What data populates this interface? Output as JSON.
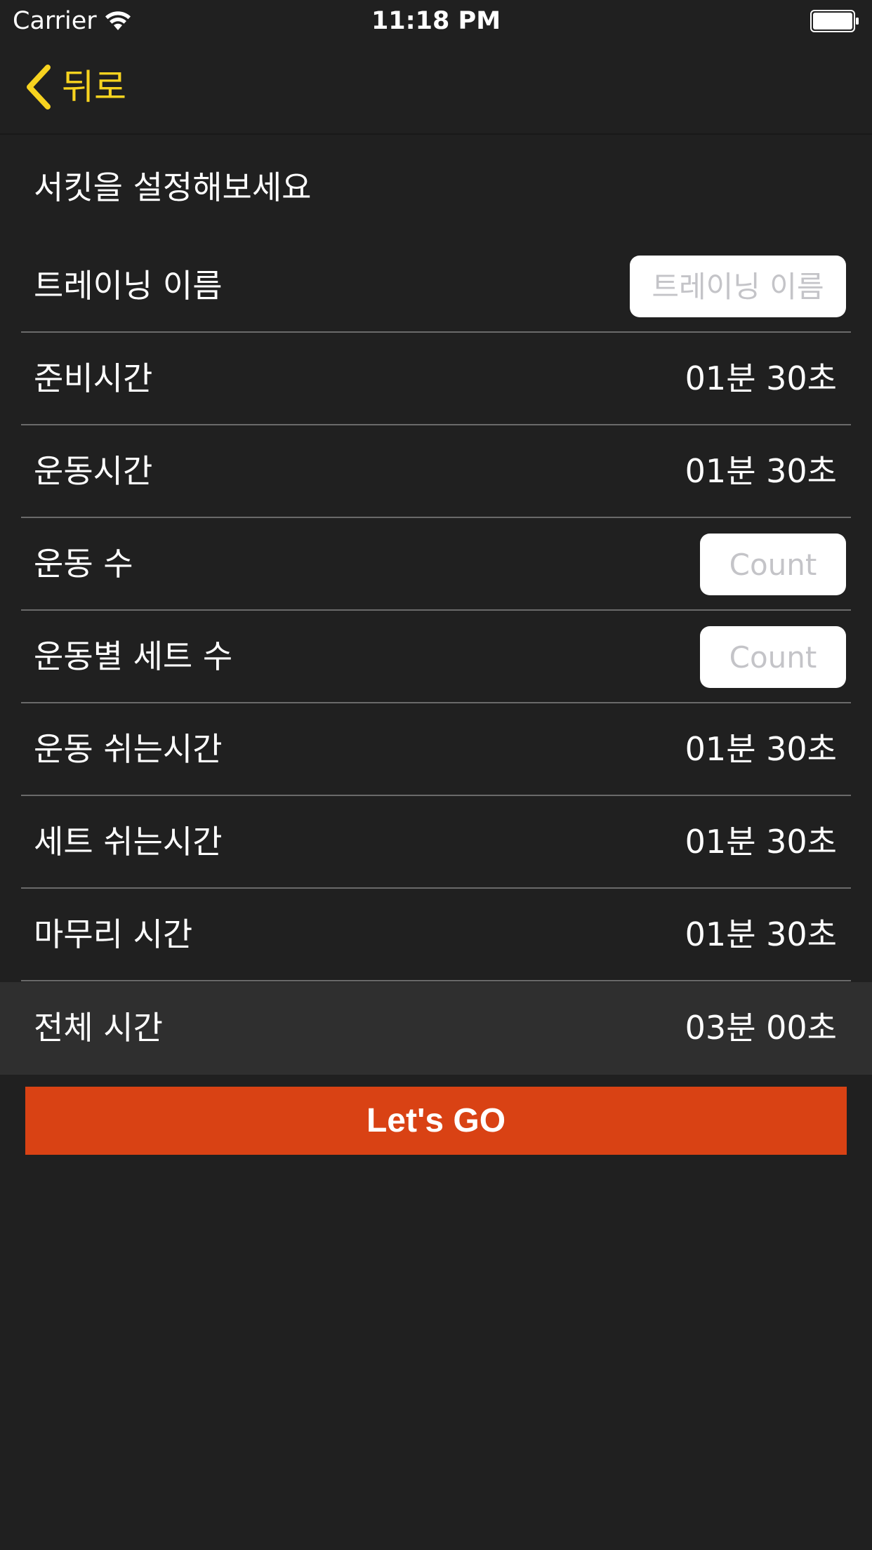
{
  "status_bar": {
    "carrier": "Carrier",
    "time": "11:18 PM",
    "wifi_icon": "wifi-icon",
    "battery_icon": "battery-icon"
  },
  "nav": {
    "back_icon": "chevron-left-icon",
    "back_label": "뒤로",
    "accent_color": "#f7d31f"
  },
  "form": {
    "title": "서킷을 설정해보세요",
    "training_name": {
      "label": "트레이닝 이름",
      "value": "",
      "placeholder": "트레이닝 이름"
    },
    "prep_time": {
      "label": "준비시간",
      "value": "01분 30초"
    },
    "exercise_time": {
      "label": "운동시간",
      "value": "01분 30초"
    },
    "exercise_count": {
      "label": "운동 수",
      "value": "",
      "placeholder": "Count"
    },
    "sets_per_exercise": {
      "label": "운동별 세트 수",
      "value": "",
      "placeholder": "Count"
    },
    "exercise_rest": {
      "label": "운동 쉬는시간",
      "value": "01분 30초"
    },
    "set_rest": {
      "label": "세트 쉬는시간",
      "value": "01분 30초"
    },
    "cooldown_time": {
      "label": "마무리 시간",
      "value": "01분 30초"
    },
    "total_time": {
      "label": "전체 시간",
      "value": "03분 00초"
    }
  },
  "actions": {
    "go_label": "Let's GO",
    "go_color": "#d94214"
  }
}
